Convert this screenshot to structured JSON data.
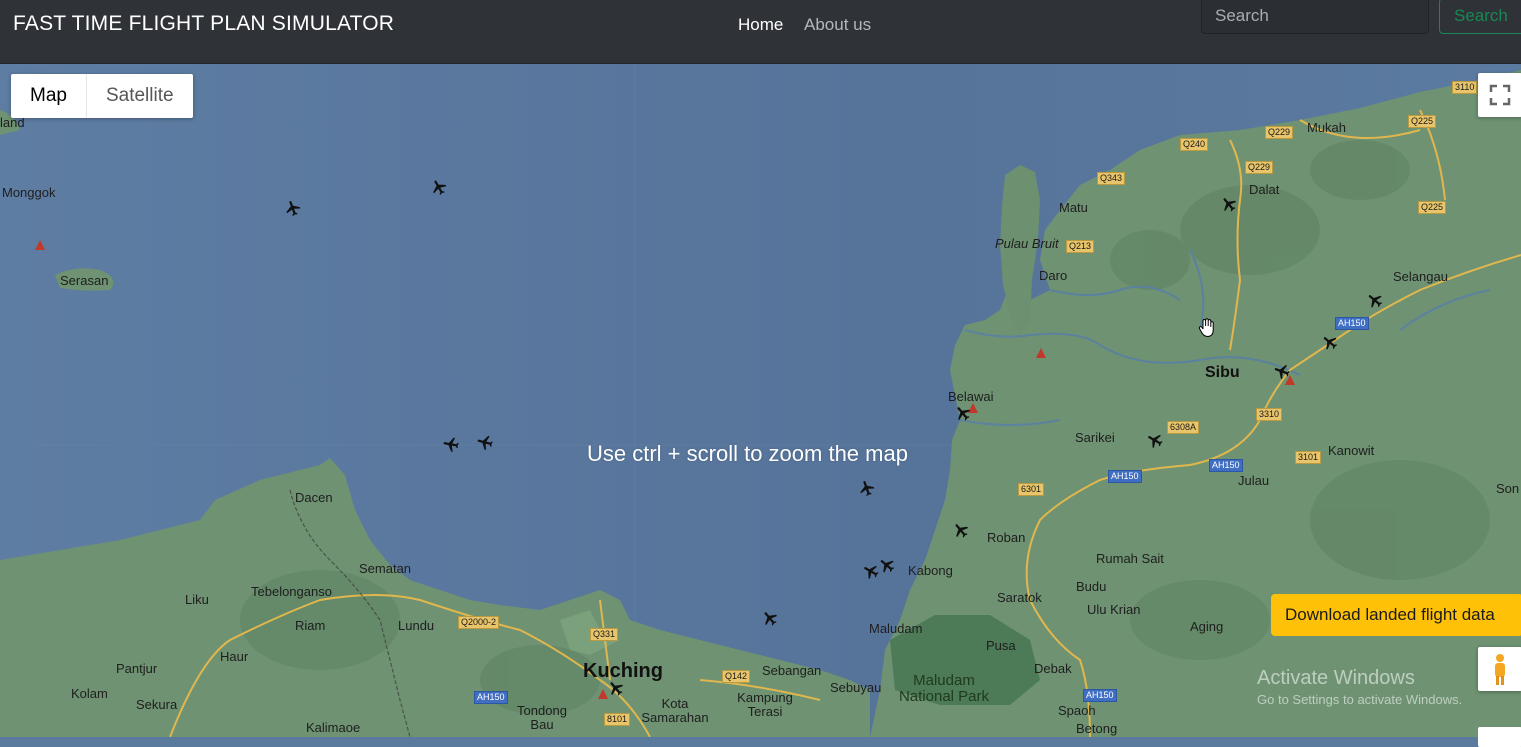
{
  "app": {
    "title": "FAST TIME FLIGHT PLAN SIMULATOR",
    "nav": {
      "home": "Home",
      "about": "About us"
    },
    "search": {
      "placeholder": "Search",
      "button": "Search"
    }
  },
  "map": {
    "type_control": {
      "map": "Map",
      "satellite": "Satellite",
      "selected": "Map"
    },
    "hint": "Use ctrl + scroll to zoom the map",
    "download_button": "Download landed flight data",
    "overlay": {
      "line1": "Activate Windows",
      "line2": "Go to Settings to activate Windows."
    },
    "places": {
      "land": "land",
      "monggok": "Monggok",
      "serasan": "Serasan",
      "mukah": "Mukah",
      "dalat": "Dalat",
      "matu": "Matu",
      "pulau_bruit": "Pulau Bruit",
      "daro": "Daro",
      "selangau": "Selangau",
      "sibu": "Sibu",
      "belawai": "Belawai",
      "sarikei": "Sarikei",
      "kanowit": "Kanowit",
      "julau": "Julau",
      "son": "Son",
      "dacen": "Dacen",
      "roban": "Roban",
      "sematan": "Sematan",
      "tebelonganso": "Tebelonganso",
      "kabong": "Kabong",
      "rumah_sait": "Rumah Sait",
      "budu": "Budu",
      "liku": "Liku",
      "riam": "Riam",
      "lundu": "Lundu",
      "saratok": "Saratok",
      "ulu_krian": "Ulu Krian",
      "aging": "Aging",
      "maludam": "Maludam",
      "pantjur": "Pantjur",
      "haur": "Haur",
      "kuching": "Kuching",
      "pusa": "Pusa",
      "sebangan": "Sebangan",
      "debak": "Debak",
      "kolam": "Kolam",
      "maludam_np": "Maludam National Park",
      "sekura": "Sekura",
      "kota_samarahan": "Kota Samarahan",
      "kampung_terasi": "Kampung Terasi",
      "sebuyau": "Sebuyau",
      "tondong_bau": "Tondong Bau",
      "spaoh": "Spaoh",
      "kalimaoe": "Kalimaoe",
      "betong": "Betong"
    },
    "roads": {
      "r3110": "3110",
      "q229a": "Q229",
      "q225a": "Q225",
      "q240": "Q240",
      "q229b": "Q229",
      "q343": "Q343",
      "q225b": "Q225",
      "q213": "Q213",
      "ah150a": "AH150",
      "r3310": "3310",
      "r6308a": "6308A",
      "ah150b": "AH150",
      "r3101": "3101",
      "ah150c": "AH150",
      "r6301": "6301",
      "q2000": "Q2000-2",
      "q331": "Q331",
      "q142": "Q142",
      "ah150d": "AH150",
      "r8101": "8101",
      "ah150e": "AH150"
    },
    "icons": {
      "plane": "airplane-icon",
      "airport": "airport-marker-icon",
      "fullscreen": "fullscreen-icon",
      "pegman": "pegman-icon",
      "cursor": "hand-cursor-icon"
    },
    "colors": {
      "sea": "#5a7a9e",
      "land": "#6e9272",
      "road": "#e8c56a",
      "highway": "#3f6ec2",
      "accent": "#ffc107",
      "nav": "#2f3338"
    }
  }
}
